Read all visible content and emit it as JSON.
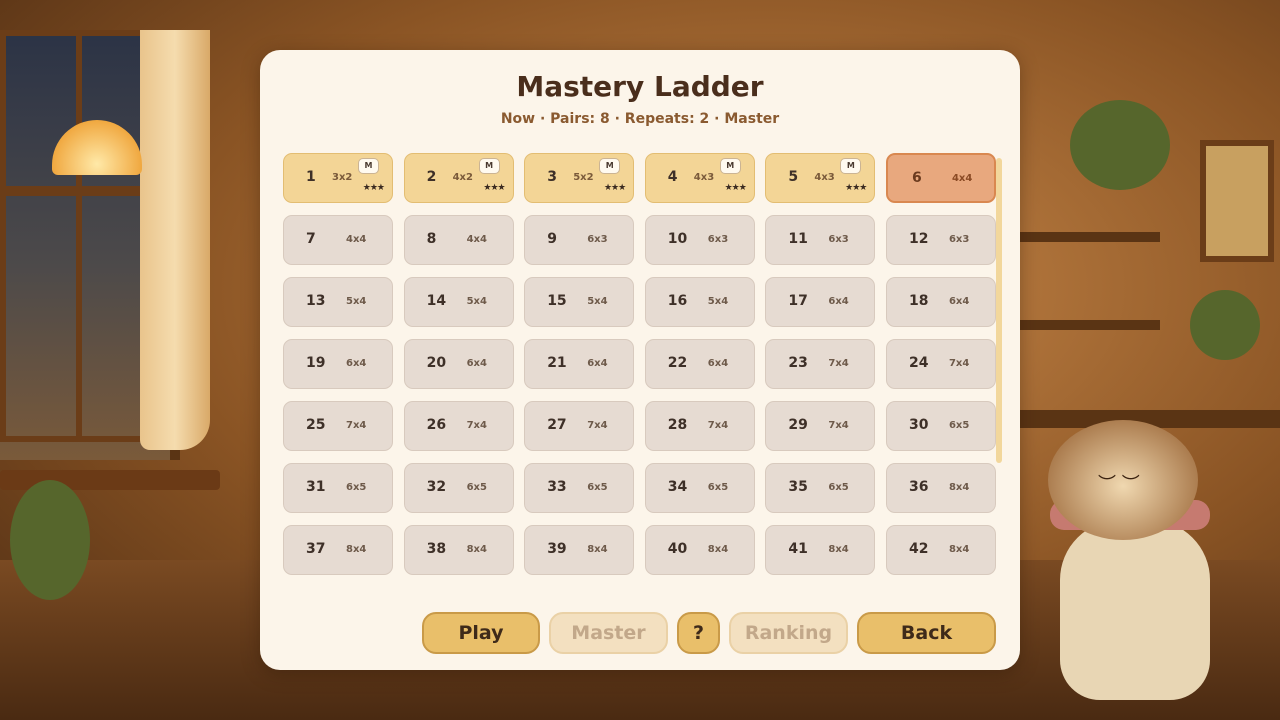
{
  "panel": {
    "title": "Mastery Ladder",
    "subtitle": "Now · Pairs: 8 · Repeats: 2 · Master"
  },
  "levels": [
    {
      "num": "1",
      "size": "3x2",
      "status": "done",
      "badge": "M",
      "stars": "★★★"
    },
    {
      "num": "2",
      "size": "4x2",
      "status": "done",
      "badge": "M",
      "stars": "★★★"
    },
    {
      "num": "3",
      "size": "5x2",
      "status": "done",
      "badge": "M",
      "stars": "★★★"
    },
    {
      "num": "4",
      "size": "4x3",
      "status": "done",
      "badge": "M",
      "stars": "★★★"
    },
    {
      "num": "5",
      "size": "4x3",
      "status": "done",
      "badge": "M",
      "stars": "★★★"
    },
    {
      "num": "6",
      "size": "4x4",
      "status": "current"
    },
    {
      "num": "7",
      "size": "4x4",
      "status": "locked"
    },
    {
      "num": "8",
      "size": "4x4",
      "status": "locked"
    },
    {
      "num": "9",
      "size": "6x3",
      "status": "locked"
    },
    {
      "num": "10",
      "size": "6x3",
      "status": "locked"
    },
    {
      "num": "11",
      "size": "6x3",
      "status": "locked"
    },
    {
      "num": "12",
      "size": "6x3",
      "status": "locked"
    },
    {
      "num": "13",
      "size": "5x4",
      "status": "locked"
    },
    {
      "num": "14",
      "size": "5x4",
      "status": "locked"
    },
    {
      "num": "15",
      "size": "5x4",
      "status": "locked"
    },
    {
      "num": "16",
      "size": "5x4",
      "status": "locked"
    },
    {
      "num": "17",
      "size": "6x4",
      "status": "locked"
    },
    {
      "num": "18",
      "size": "6x4",
      "status": "locked"
    },
    {
      "num": "19",
      "size": "6x4",
      "status": "locked"
    },
    {
      "num": "20",
      "size": "6x4",
      "status": "locked"
    },
    {
      "num": "21",
      "size": "6x4",
      "status": "locked"
    },
    {
      "num": "22",
      "size": "6x4",
      "status": "locked"
    },
    {
      "num": "23",
      "size": "7x4",
      "status": "locked"
    },
    {
      "num": "24",
      "size": "7x4",
      "status": "locked"
    },
    {
      "num": "25",
      "size": "7x4",
      "status": "locked"
    },
    {
      "num": "26",
      "size": "7x4",
      "status": "locked"
    },
    {
      "num": "27",
      "size": "7x4",
      "status": "locked"
    },
    {
      "num": "28",
      "size": "7x4",
      "status": "locked"
    },
    {
      "num": "29",
      "size": "7x4",
      "status": "locked"
    },
    {
      "num": "30",
      "size": "6x5",
      "status": "locked"
    },
    {
      "num": "31",
      "size": "6x5",
      "status": "locked"
    },
    {
      "num": "32",
      "size": "6x5",
      "status": "locked"
    },
    {
      "num": "33",
      "size": "6x5",
      "status": "locked"
    },
    {
      "num": "34",
      "size": "6x5",
      "status": "locked"
    },
    {
      "num": "35",
      "size": "6x5",
      "status": "locked"
    },
    {
      "num": "36",
      "size": "8x4",
      "status": "locked"
    },
    {
      "num": "37",
      "size": "8x4",
      "status": "locked"
    },
    {
      "num": "38",
      "size": "8x4",
      "status": "locked"
    },
    {
      "num": "39",
      "size": "8x4",
      "status": "locked"
    },
    {
      "num": "40",
      "size": "8x4",
      "status": "locked"
    },
    {
      "num": "41",
      "size": "8x4",
      "status": "locked"
    },
    {
      "num": "42",
      "size": "8x4",
      "status": "locked"
    }
  ],
  "buttons": {
    "play": "Play",
    "master": "Master",
    "help": "?",
    "ranking": "Ranking",
    "back": "Back"
  },
  "colors": {
    "done": "#f3d596",
    "current": "#e8a87e",
    "locked": "#e6dbd2",
    "button_active": "#e9bf6a",
    "button_disabled": "#f3e0c0"
  },
  "icons": [
    "mastery-badge-icon",
    "star-icon"
  ]
}
